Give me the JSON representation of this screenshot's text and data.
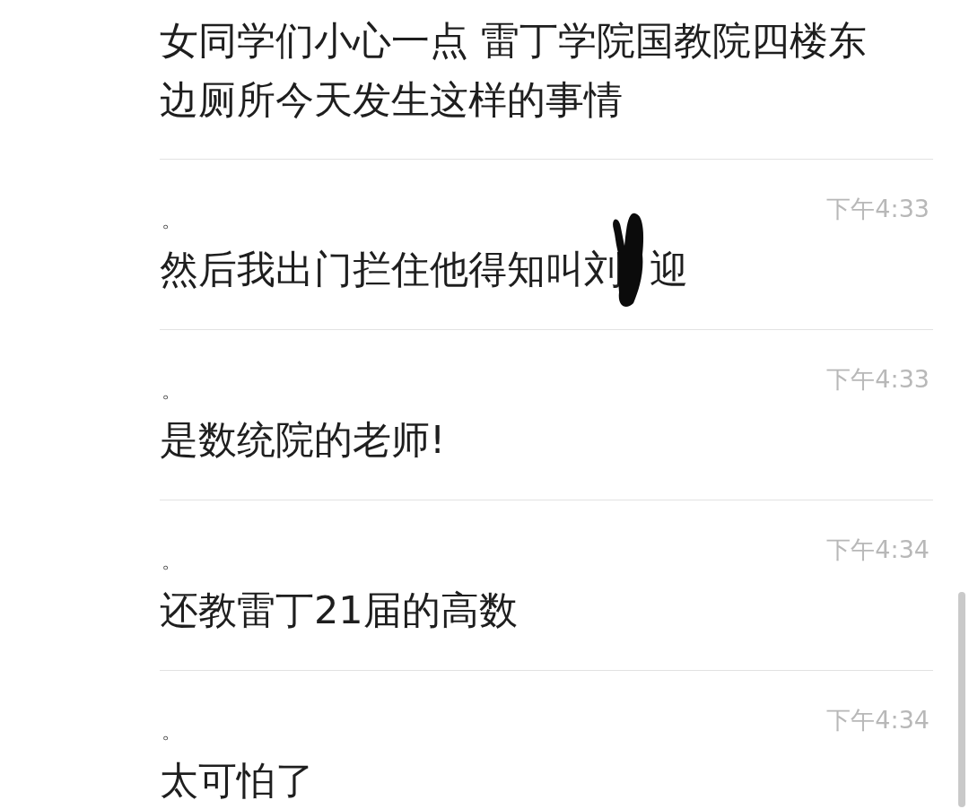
{
  "messages": [
    {
      "parts": [
        {
          "kind": "text",
          "text": "女同学们小心一点 雷丁学院国教院四楼东边厕所今天发生这样的事情"
        }
      ]
    },
    {
      "sender": "。",
      "time": "下午4:33",
      "parts": [
        {
          "kind": "text",
          "text": "然后我出门拦住他得知叫刘"
        },
        {
          "kind": "redaction"
        },
        {
          "kind": "text",
          "text": "迎"
        }
      ]
    },
    {
      "sender": "。",
      "time": "下午4:33",
      "parts": [
        {
          "kind": "text",
          "text": "是数统院的老师!"
        }
      ]
    },
    {
      "sender": "。",
      "time": "下午4:34",
      "parts": [
        {
          "kind": "text",
          "text": "还教雷丁21届的高数"
        }
      ]
    },
    {
      "sender": "。",
      "time": "下午4:34",
      "parts": [
        {
          "kind": "text",
          "text": "太可怕了"
        }
      ]
    }
  ]
}
